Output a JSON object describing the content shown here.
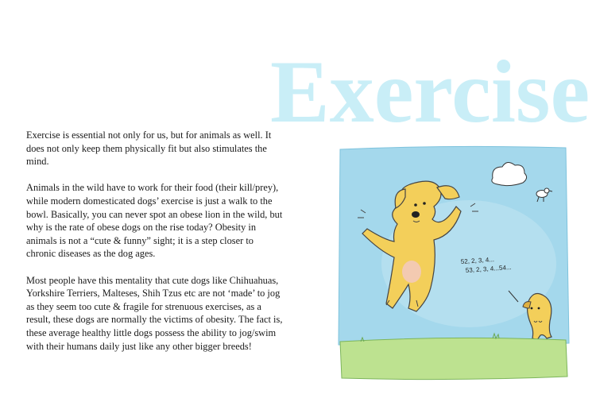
{
  "page": {
    "title": "Exercise",
    "paragraphs": [
      "Exercise is essential not only for us, but for animals as well. It does not only keep them physically fit but also stimulates the mind.",
      "Animals in the wild have to work for their food (their kill/prey), while modern domesticated dogs’ exercise is just a walk to the bowl. Basically, you can never spot an obese lion in the wild, but why is the rate of obese dogs on the rise today? Obesity in animals is not a “cute & funny” sight; it is a step closer to chronic diseases as the dog ages.",
      "Most people have this mentality that cute dogs like Chihuahuas, Yorkshire Terriers, Malteses, Shih Tzus etc are not ‘made’ to jog as they seem too cute & fragile for strenuous exercises, as a result, these dogs are normally the victims of obesity. The fact is, these average healthy little dogs possess the ability to jog/swim with their humans daily just like any other bigger breeds!"
    ]
  },
  "illustration": {
    "count_line_1": "52, 2, 3, 4...",
    "count_line_2": "53, 2, 3, 4...54...",
    "colors": {
      "sky": "#9fd6ea",
      "grass": "#b8e08a",
      "dog": "#f3cf5a",
      "title": "#c9eef7"
    }
  }
}
